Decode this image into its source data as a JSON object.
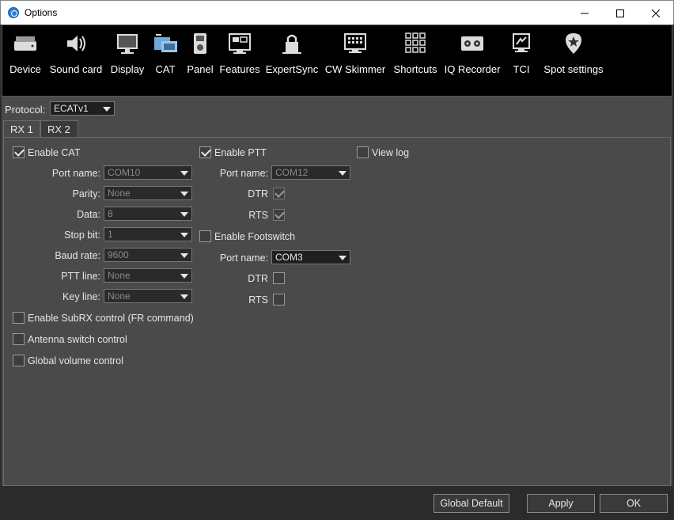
{
  "window": {
    "title": "Options",
    "minimize_glyph": "—",
    "maximize_glyph": "☐",
    "close_glyph": "✕"
  },
  "toolbar": {
    "items": [
      {
        "label": "Device",
        "icon": "device-icon"
      },
      {
        "label": "Sound card",
        "icon": "speaker-icon"
      },
      {
        "label": "Display",
        "icon": "monitor-icon"
      },
      {
        "label": "CAT",
        "icon": "cat-icon"
      },
      {
        "label": "Panel",
        "icon": "panel-icon"
      },
      {
        "label": "Features",
        "icon": "features-icon"
      },
      {
        "label": "ExpertSync",
        "icon": "lock-icon"
      },
      {
        "label": "CW Skimmer",
        "icon": "keyboard-icon"
      },
      {
        "label": "Shortcuts",
        "icon": "grid-icon"
      },
      {
        "label": "IQ Recorder",
        "icon": "tape-icon"
      },
      {
        "label": "TCI",
        "icon": "tci-icon"
      },
      {
        "label": "Spot settings",
        "icon": "location-icon"
      }
    ]
  },
  "protocol": {
    "label": "Protocol:",
    "value": "ECATv1"
  },
  "tabs": [
    {
      "label": "RX 1",
      "active": true
    },
    {
      "label": "RX 2",
      "active": false
    }
  ],
  "cat": {
    "enable_label": "Enable CAT",
    "enabled": true,
    "fields": [
      {
        "label": "Port name:",
        "value": "COM10"
      },
      {
        "label": "Parity:",
        "value": "None"
      },
      {
        "label": "Data:",
        "value": "8"
      },
      {
        "label": "Stop bit:",
        "value": "1"
      },
      {
        "label": "Baud rate:",
        "value": "9600"
      },
      {
        "label": "PTT line:",
        "value": "None"
      },
      {
        "label": "Key line:",
        "value": "None"
      }
    ],
    "options": [
      {
        "label": "Enable SubRX control (FR command)",
        "checked": false
      },
      {
        "label": "Antenna switch control",
        "checked": false
      },
      {
        "label": "Global volume control",
        "checked": false
      }
    ]
  },
  "ptt": {
    "enable_label": "Enable PTT",
    "enabled": true,
    "port_label": "Port name:",
    "port_value": "COM12",
    "dtr_label": "DTR",
    "dtr_checked": true,
    "rts_label": "RTS",
    "rts_checked": true
  },
  "footswitch": {
    "enable_label": "Enable Footswitch",
    "enabled": false,
    "port_label": "Port name:",
    "port_value": "COM3",
    "dtr_label": "DTR",
    "dtr_checked": false,
    "rts_label": "RTS",
    "rts_checked": false
  },
  "view_log": {
    "label": "View log",
    "checked": false
  },
  "buttons": {
    "global_default": "Global Default",
    "apply": "Apply",
    "ok": "OK"
  }
}
